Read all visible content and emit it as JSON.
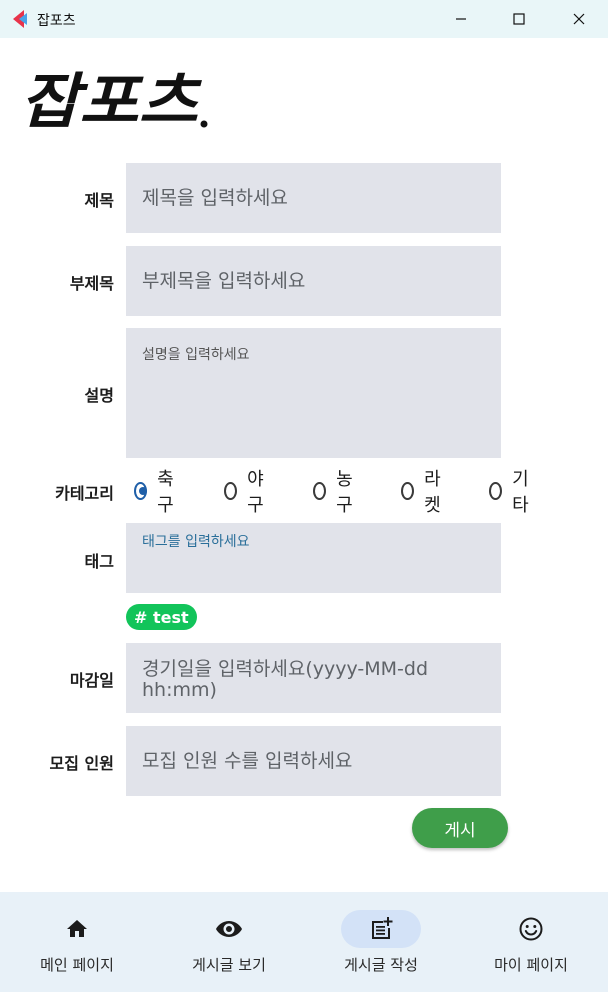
{
  "window": {
    "title": "잡포츠"
  },
  "logo": {
    "text": "잡포츠"
  },
  "form": {
    "title": {
      "label": "제목",
      "placeholder": "제목을 입력하세요"
    },
    "subtitle": {
      "label": "부제목",
      "placeholder": "부제목을 입력하세요"
    },
    "description": {
      "label": "설명",
      "placeholder": "설명을 입력하세요"
    },
    "category": {
      "label": "카테고리",
      "options": [
        "축구",
        "야구",
        "농구",
        "라켓",
        "기타"
      ],
      "selected": "축구"
    },
    "tag": {
      "label": "태그",
      "placeholder": "태그를 입력하세요",
      "chips": [
        "# test"
      ]
    },
    "deadline": {
      "label": "마감일",
      "placeholder": "경기일을 입력하세요(yyyy-MM-dd hh:mm)"
    },
    "recruit": {
      "label": "모집 인원",
      "placeholder": "모집 인원 수를 입력하세요"
    },
    "submit_label": "게시"
  },
  "nav": {
    "items": [
      {
        "label": "메인 페이지",
        "icon": "home-icon"
      },
      {
        "label": "게시글 보기",
        "icon": "eye-icon"
      },
      {
        "label": "게시글 작성",
        "icon": "post-add-icon",
        "active": true
      },
      {
        "label": "마이 페이지",
        "icon": "smiley-icon"
      }
    ]
  },
  "colors": {
    "accent": "#1f5fa8",
    "submit": "#3f9e4a",
    "chip": "#12c45a",
    "field": "#e1e3ea"
  }
}
